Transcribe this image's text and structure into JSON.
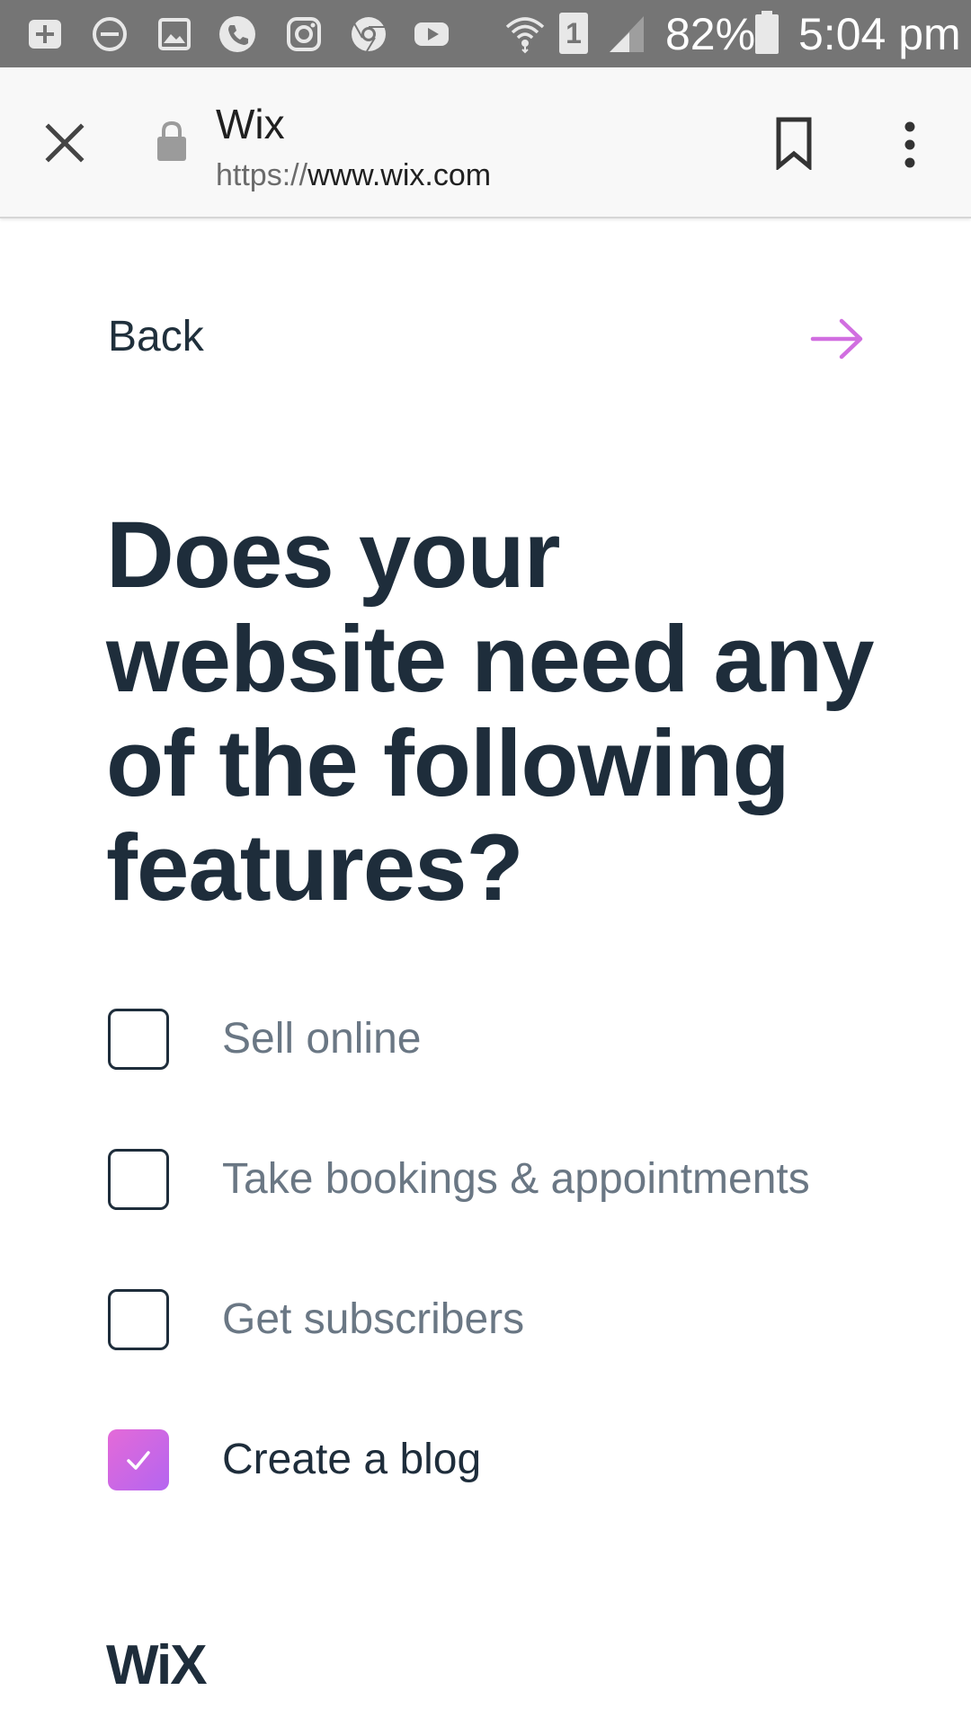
{
  "status_bar": {
    "battery_percent": "82%",
    "time": "5:04 pm",
    "sim_slot": "1",
    "icons": [
      "add-box-icon",
      "do-not-disturb-icon",
      "image-icon",
      "phone-icon",
      "instagram-icon",
      "chrome-icon",
      "youtube-icon",
      "wifi-icon",
      "sim-icon",
      "signal-icon",
      "battery-icon"
    ]
  },
  "browser": {
    "page_title": "Wix",
    "url_scheme": "https://",
    "url_host": "www.wix.com"
  },
  "nav": {
    "back_label": "Back",
    "accent_color": "#d16ee0"
  },
  "question": "Does your website need any of the following features?",
  "options": [
    {
      "label": "Sell online",
      "checked": false
    },
    {
      "label": "Take bookings & appointments",
      "checked": false
    },
    {
      "label": "Get subscribers",
      "checked": false
    },
    {
      "label": "Create a blog",
      "checked": true
    }
  ],
  "footer": {
    "logo_text": "WiX"
  }
}
